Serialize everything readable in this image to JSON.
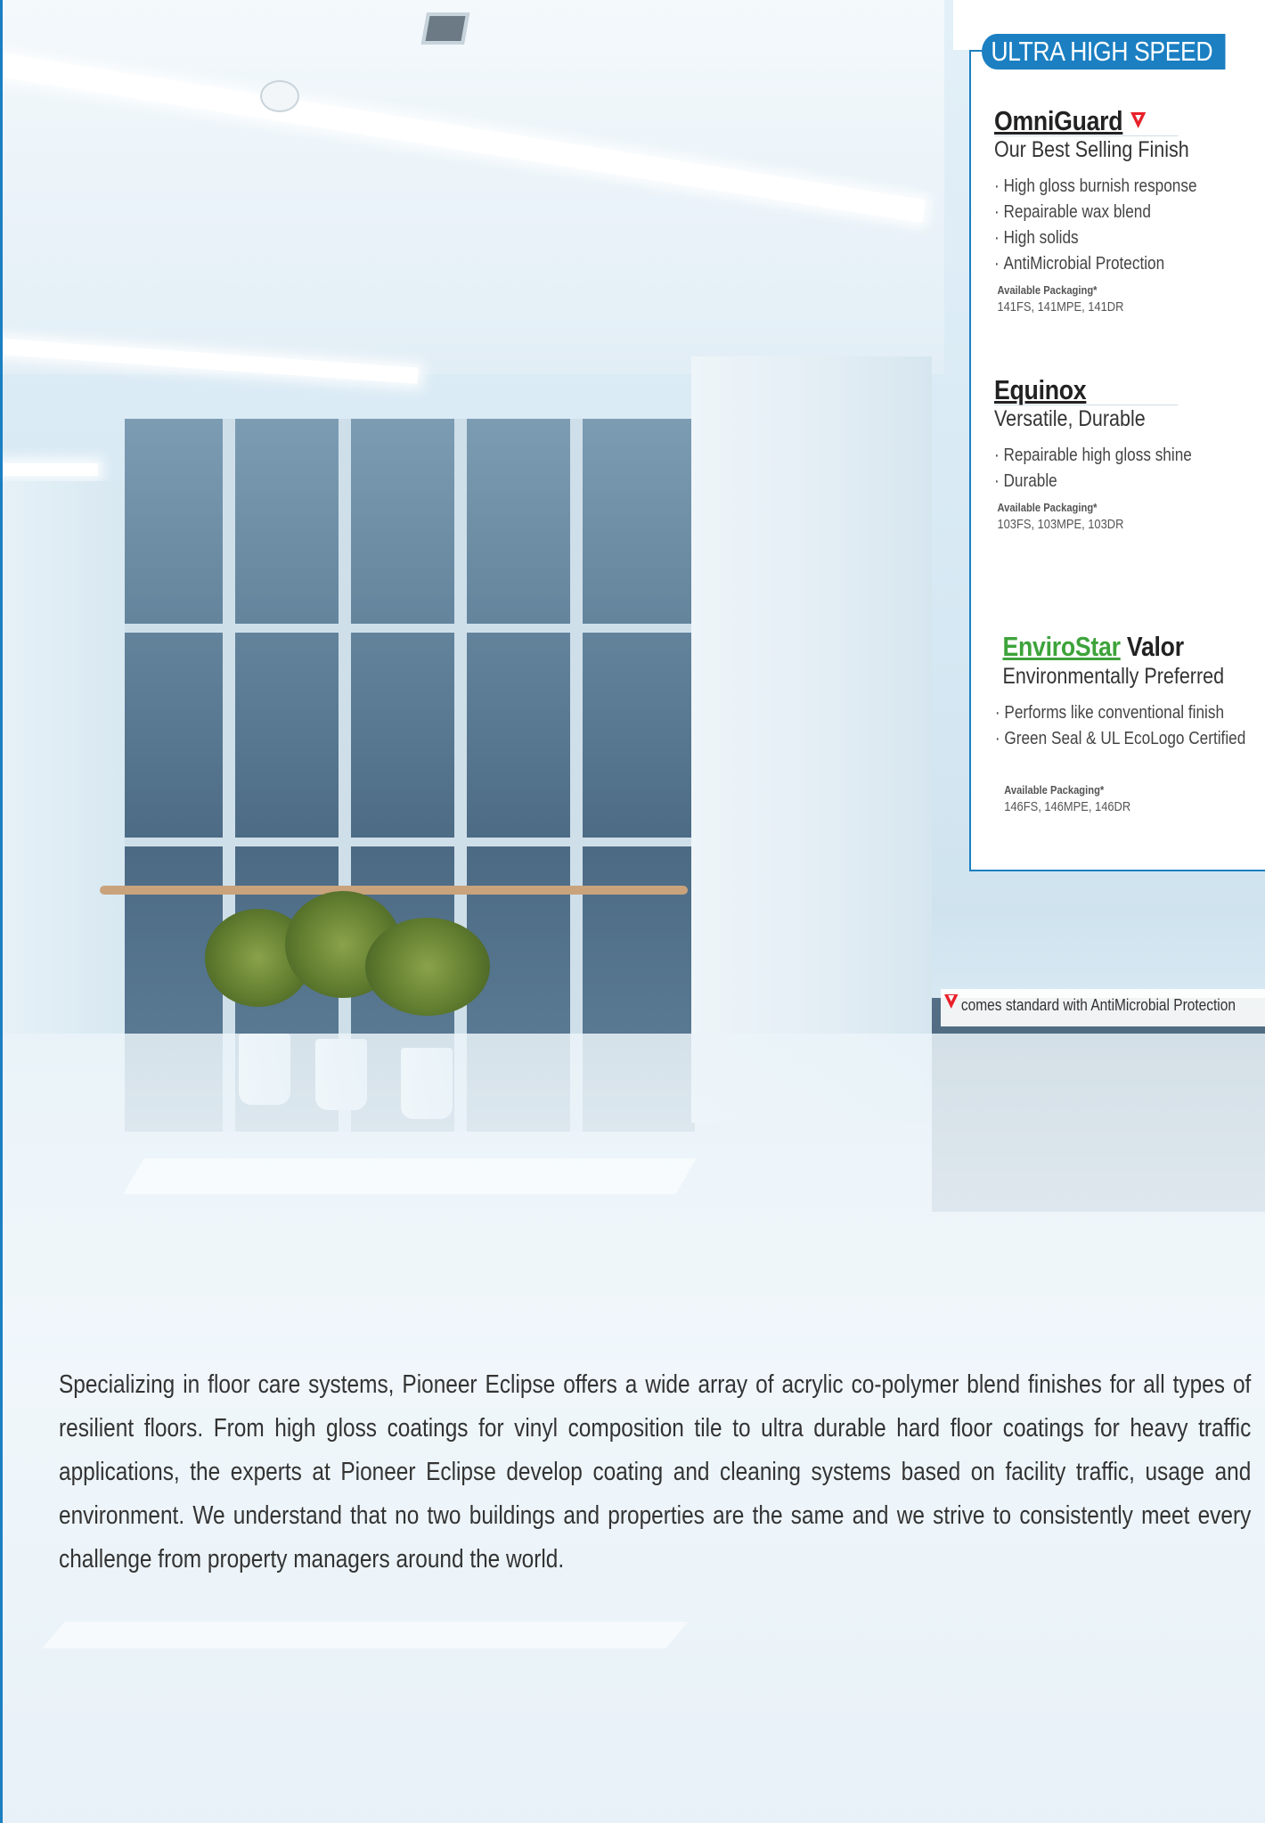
{
  "section_tab": "ULTRA HIGH SPEED",
  "products": [
    {
      "name": "OmniGuard",
      "tagline": "Our Best Selling Finish",
      "features": [
        "High gloss burnish response",
        "Repairable wax blend",
        "High solids",
        "AntiMicrobial Protection"
      ],
      "packaging_label": "Available Packaging*",
      "packaging_codes": "141FS, 141MPE, 141DR",
      "icon": "antimicrobial-triangle-icon"
    },
    {
      "name": "Equinox",
      "tagline": "Versatile, Durable",
      "features": [
        "Repairable high gloss shine",
        "Durable"
      ],
      "packaging_label": "Available Packaging*",
      "packaging_codes": "103FS, 103MPE, 103DR"
    },
    {
      "name_prefix": "EnviroStar",
      "name": "Valor",
      "tagline": "Environmentally Preferred",
      "features": [
        "Performs like conventional finish",
        "Green Seal & UL EcoLogo Certified"
      ],
      "packaging_label": "Available Packaging*",
      "packaging_codes": "146FS, 146MPE, 146DR"
    }
  ],
  "footnote": "comes standard with AntiMicrobial Protection",
  "body_text": "Specializing in floor care systems,  Pioneer Eclipse offers a wide array of acrylic co-polymer blend finishes for all types of resilient floors. From high gloss coatings for vinyl composition tile to ultra durable hard floor coatings for heavy traffic applications, the experts at Pioneer Eclipse develop coating and cleaning systems based on facility traffic, usage and environment. We understand that no two buildings and properties are the same and we strive to consistently meet every challenge from property managers around the world.",
  "colors": {
    "accent_blue": "#1b7fc2",
    "enviro_green": "#3da33a",
    "antimicrobial_red": "#e8202a"
  }
}
